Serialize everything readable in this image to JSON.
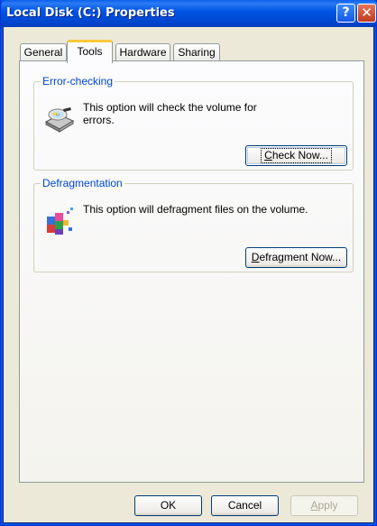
{
  "window": {
    "title": "Local Disk (C:) Properties"
  },
  "titlebar": {
    "help_glyph": "?",
    "close_glyph": "✕",
    "help_icon": "help-icon",
    "close_icon": "close-icon"
  },
  "tabs": [
    {
      "label": "General",
      "active": false
    },
    {
      "label": "Tools",
      "active": true
    },
    {
      "label": "Hardware",
      "active": false
    },
    {
      "label": "Sharing",
      "active": false
    }
  ],
  "error_checking": {
    "legend": "Error-checking",
    "icon": "disk-check-icon",
    "description": "This option will check the volume for errors.",
    "button_accel": "C",
    "button_rest": "heck Now..."
  },
  "defragmentation": {
    "legend": "Defragmentation",
    "icon": "defragment-icon",
    "description": "This option will defragment files on the volume.",
    "button_accel": "D",
    "button_rest": "efragment Now..."
  },
  "footer": {
    "ok": "OK",
    "cancel": "Cancel",
    "apply_accel": "A",
    "apply_rest": "pply"
  },
  "colors": {
    "title_bar": "#0055E5",
    "window_face": "#ECE9D8",
    "group_legend": "#0046D5",
    "active_tab_highlight": "#FFC83C",
    "close_button": "#C13A1D"
  }
}
